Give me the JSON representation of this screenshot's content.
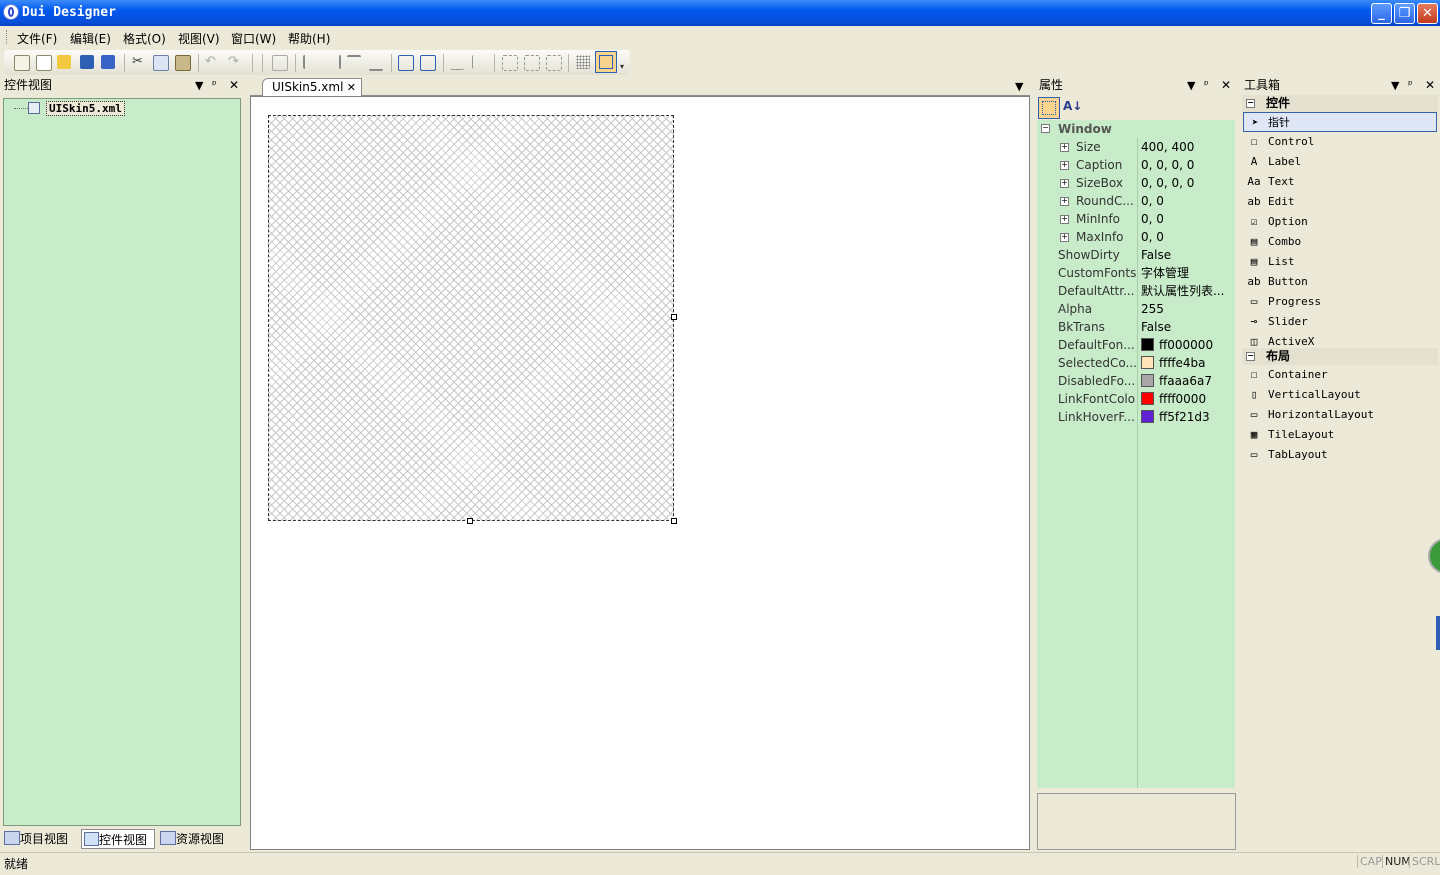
{
  "window": {
    "title": "Dui Designer",
    "minimize": "_",
    "restore": "❐",
    "close": "✕"
  },
  "menu": [
    "文件(F)",
    "编辑(E)",
    "格式(O)",
    "视图(V)",
    "窗口(W)",
    "帮助(H)"
  ],
  "toolbar": {
    "buttons": [
      "new-file-icon",
      "new-window-icon",
      "open-icon",
      "save-icon",
      "save-all-icon",
      "cut-icon",
      "copy-icon",
      "paste-icon",
      "undo-icon",
      "redo-icon",
      "tab-order-icon",
      "align-left-icon",
      "align-right-icon",
      "align-top-icon",
      "align-bottom-icon",
      "center-horizontal-icon",
      "center-vertical-icon",
      "same-width-icon",
      "same-height-icon",
      "space-across-icon",
      "space-down-icon",
      "size-to-content-icon",
      "grid-icon",
      "frame-icon"
    ]
  },
  "left_panel": {
    "title": "控件视图",
    "tree_root": "UISkin5.xml",
    "tabs": [
      "项目视图",
      "控件视图",
      "资源视图"
    ]
  },
  "document": {
    "tab_label": "UISkin5.xml",
    "tab_close": "✕"
  },
  "properties": {
    "title": "属性",
    "category": "Window",
    "rows": [
      {
        "name": "Size",
        "value": "400, 400",
        "expandable": true
      },
      {
        "name": "Caption",
        "value": "0, 0, 0, 0",
        "expandable": true
      },
      {
        "name": "SizeBox",
        "value": "0, 0, 0, 0",
        "expandable": true
      },
      {
        "name": "RoundC...",
        "value": "0, 0",
        "expandable": true
      },
      {
        "name": "MinInfo",
        "value": "0, 0",
        "expandable": true
      },
      {
        "name": "MaxInfo",
        "value": "0, 0",
        "expandable": true
      },
      {
        "name": "ShowDirty",
        "value": "False",
        "expandable": false
      },
      {
        "name": "CustomFonts",
        "value": "字体管理",
        "expandable": false
      },
      {
        "name": "DefaultAttr...",
        "value": "默认属性列表...",
        "expandable": false
      },
      {
        "name": "Alpha",
        "value": "255",
        "expandable": false
      },
      {
        "name": "BkTrans",
        "value": "False",
        "expandable": false
      },
      {
        "name": "DefaultFon...",
        "value": "ff000000",
        "expandable": false,
        "color": "#000000"
      },
      {
        "name": "SelectedCo...",
        "value": "ffffe4ba",
        "expandable": false,
        "color": "#ffe4ba"
      },
      {
        "name": "DisabledFo...",
        "value": "ffaaa6a7",
        "expandable": false,
        "color": "#aaa6a7"
      },
      {
        "name": "LinkFontColor",
        "value": "ffff0000",
        "expandable": false,
        "color": "#ff0000"
      },
      {
        "name": "LinkHoverF...",
        "value": "ff5f21d3",
        "expandable": false,
        "color": "#5f21d3"
      }
    ]
  },
  "toolbox": {
    "title": "工具箱",
    "groups": [
      {
        "name": "控件",
        "items": [
          {
            "label": "指针",
            "icon": "pointer-icon"
          },
          {
            "label": "Control",
            "icon": "control-icon"
          },
          {
            "label": "Label",
            "icon": "label-icon"
          },
          {
            "label": "Text",
            "icon": "text-icon"
          },
          {
            "label": "Edit",
            "icon": "edit-icon"
          },
          {
            "label": "Option",
            "icon": "option-icon"
          },
          {
            "label": "Combo",
            "icon": "combo-icon"
          },
          {
            "label": "List",
            "icon": "list-icon"
          },
          {
            "label": "Button",
            "icon": "button-icon"
          },
          {
            "label": "Progress",
            "icon": "progress-icon"
          },
          {
            "label": "Slider",
            "icon": "slider-icon"
          },
          {
            "label": "ActiveX",
            "icon": "activex-icon"
          }
        ]
      },
      {
        "name": "布局",
        "items": [
          {
            "label": "Container",
            "icon": "container-icon"
          },
          {
            "label": "VerticalLayout",
            "icon": "vertical-layout-icon"
          },
          {
            "label": "HorizontalLayout",
            "icon": "horizontal-layout-icon"
          },
          {
            "label": "TileLayout",
            "icon": "tile-layout-icon"
          },
          {
            "label": "TabLayout",
            "icon": "tab-layout-icon"
          }
        ]
      }
    ]
  },
  "status": {
    "text": "就绪",
    "indicators": [
      "CAP",
      "NUM",
      "SCRL"
    ]
  },
  "colors": {
    "panel_green": "#c8ecc9",
    "title_blue": "#0058ee",
    "chrome": "#ece9d8"
  }
}
